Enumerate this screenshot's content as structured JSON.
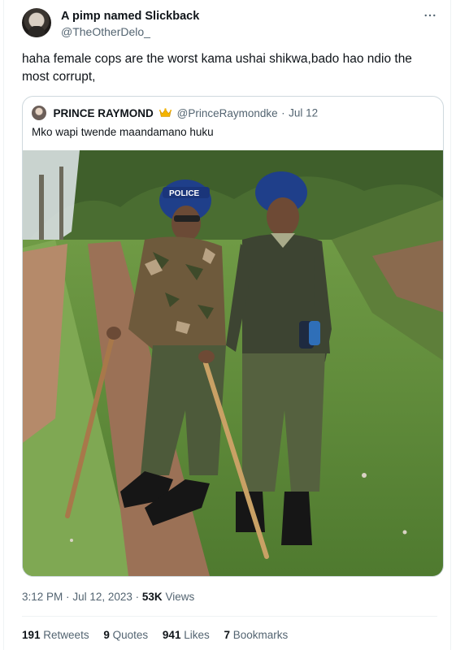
{
  "tweet": {
    "author": {
      "display_name": "A pimp named Slickback",
      "handle": "@TheOtherDelo_"
    },
    "text": "haha female cops are the worst kama ushai shikwa,bado hao ndio the most corrupt,",
    "time": "3:12 PM",
    "separator": "·",
    "date": "Jul 12, 2023",
    "views_count": "53K",
    "views_label": "Views",
    "stats": [
      {
        "count": "191",
        "label": "Retweets"
      },
      {
        "count": "9",
        "label": "Quotes"
      },
      {
        "count": "941",
        "label": "Likes"
      },
      {
        "count": "7",
        "label": "Bookmarks"
      }
    ]
  },
  "quoted": {
    "display_name": "PRINCE RAYMOND",
    "handle": "@PrinceRaymondke",
    "separator": "·",
    "date": "Jul 12",
    "text": "Mko wapi twende maandamano huku",
    "photo": {
      "helmet_text": "POLICE"
    }
  },
  "icons": {
    "more": "more-horizontal-icon",
    "verified_badge": "crown-icon"
  },
  "colors": {
    "text_primary": "#0f1419",
    "text_secondary": "#536471",
    "border": "#cfd9de"
  }
}
